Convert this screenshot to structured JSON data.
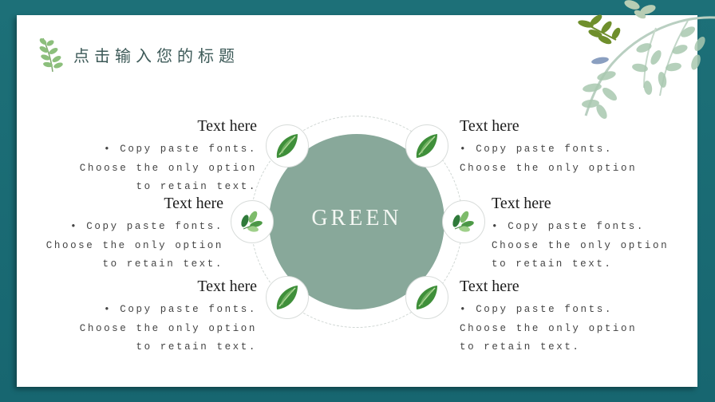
{
  "slide": {
    "title": "点击输入您的标题",
    "center_label": "GREEN",
    "colors": {
      "frame": "#1a6b72",
      "panel": "#ffffff",
      "center_circle": "#88a89a",
      "title_text": "#3d5a58"
    },
    "blocks": [
      {
        "position": "top-left",
        "heading": "Text here",
        "body": "• Copy paste fonts. Choose the only option to retain text.",
        "icon": "leaf-icon"
      },
      {
        "position": "middle-left",
        "heading": "Text here",
        "body": "• Copy paste fonts. Choose the only option to retain text.",
        "icon": "leaf-sprig-icon"
      },
      {
        "position": "bottom-left",
        "heading": "Text here",
        "body": "• Copy paste fonts. Choose the only option to retain text.",
        "icon": "leaf-icon"
      },
      {
        "position": "top-right",
        "heading": "Text here",
        "body": "• Copy paste fonts. Choose the only option",
        "icon": "leaf-icon"
      },
      {
        "position": "middle-right",
        "heading": "Text here",
        "body": "• Copy paste fonts. Choose the only option to retain text.",
        "icon": "leaf-sprig-icon"
      },
      {
        "position": "bottom-right",
        "heading": "Text here",
        "body": "• Copy paste fonts. Choose the only option to retain text.",
        "icon": "leaf-icon"
      }
    ]
  }
}
